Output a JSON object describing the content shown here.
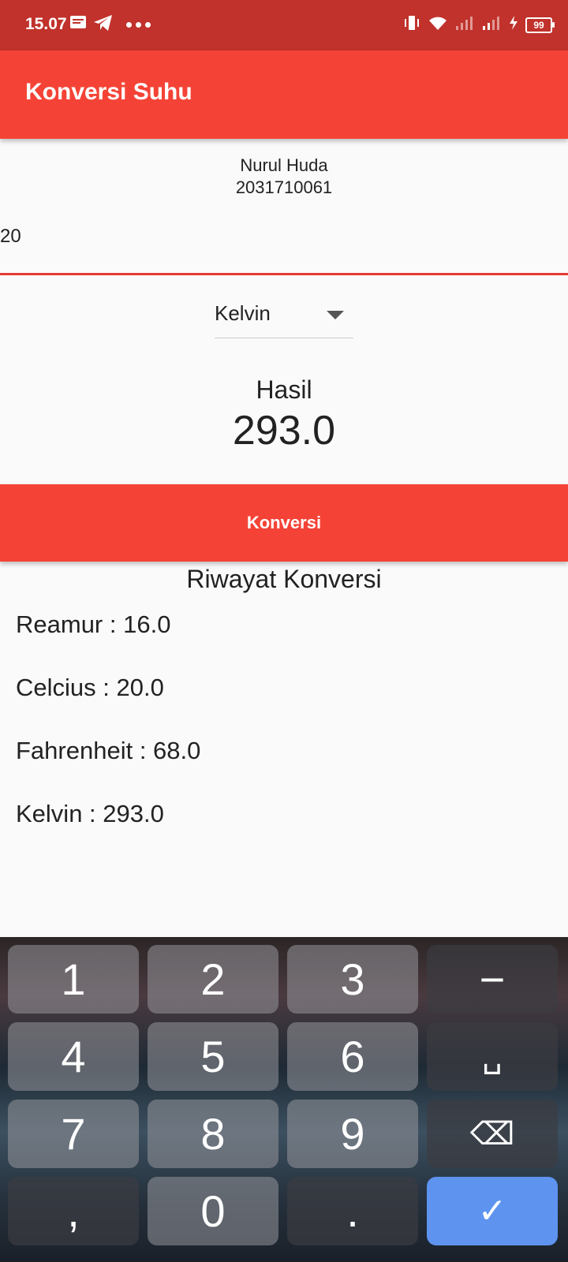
{
  "status_bar": {
    "time": "15.07",
    "battery": "99"
  },
  "app_bar": {
    "title": "Konversi Suhu"
  },
  "student": {
    "name": "Nurul Huda",
    "id": "2031710061"
  },
  "input": {
    "value": "20"
  },
  "dropdown": {
    "selected": "Kelvin"
  },
  "result": {
    "label": "Hasil",
    "value": "293.0"
  },
  "convert_button": {
    "label": "Konversi"
  },
  "history": {
    "title": "Riwayat Konversi",
    "items": [
      "Reamur : 16.0",
      "Celcius : 20.0",
      "Fahrenheit : 68.0",
      "Kelvin : 293.0"
    ]
  },
  "keyboard": {
    "keys": [
      "1",
      "2",
      "3",
      "−",
      "4",
      "5",
      "6",
      "␣",
      "7",
      "8",
      "9",
      "⌫",
      ",",
      "0",
      ".",
      "✓"
    ]
  },
  "colors": {
    "accent": "#f44336",
    "status_bar": "#c0322b",
    "keyboard_ok": "#5e94f0"
  }
}
